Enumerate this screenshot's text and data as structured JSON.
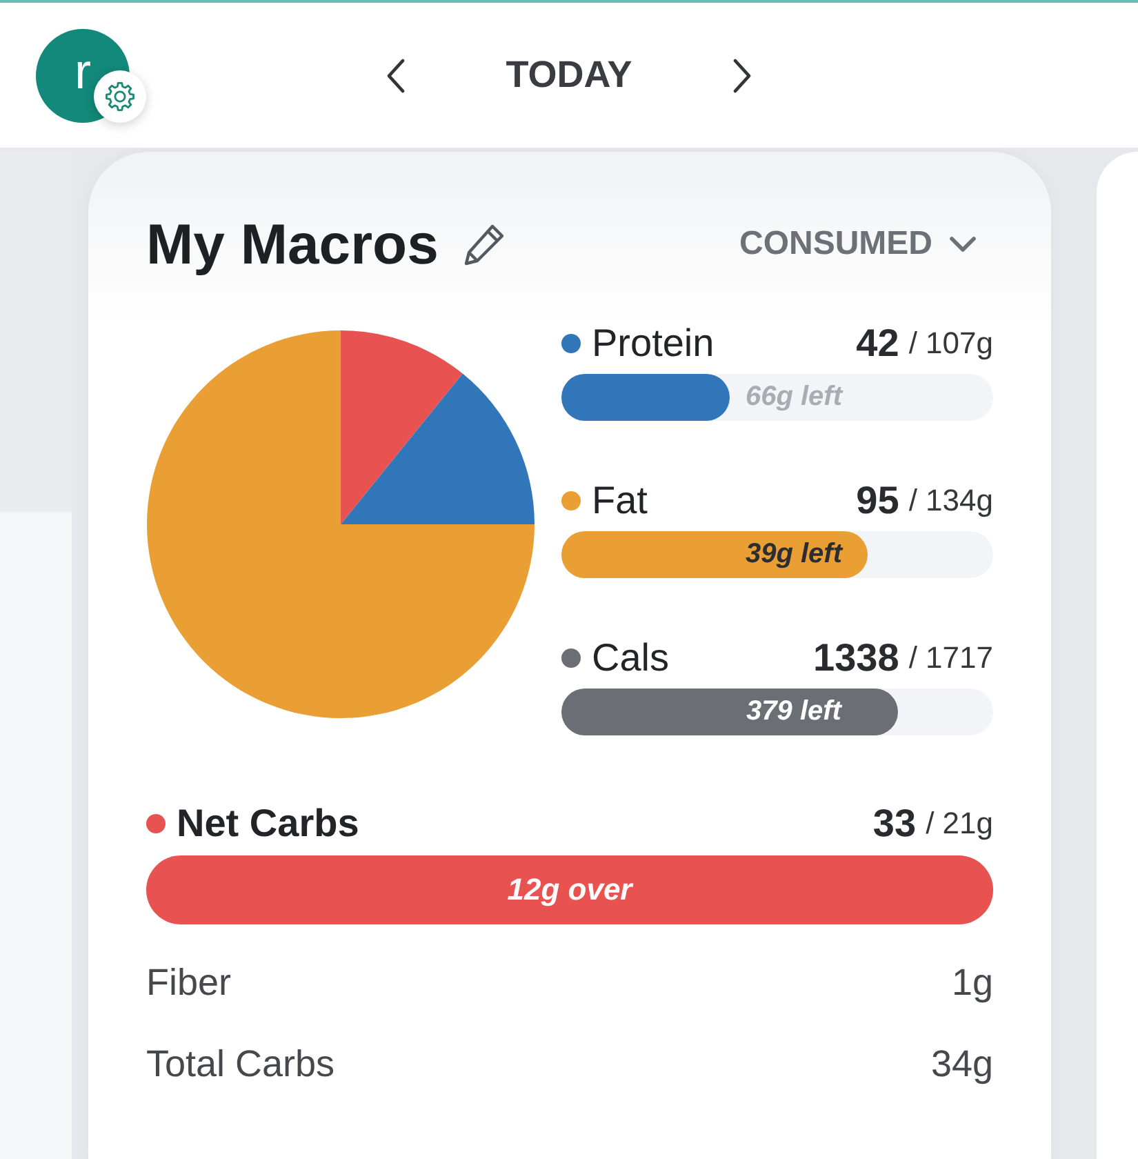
{
  "header": {
    "avatar_letter": "r",
    "date": "TODAY"
  },
  "card": {
    "title": "My Macros",
    "view_mode": "CONSUMED",
    "macros": [
      {
        "name": "Protein",
        "color": "#3176b9",
        "amount": "42",
        "goal": "/ 107g",
        "level": 0.39,
        "bar_label": "66g left"
      },
      {
        "name": "Fat",
        "color": "#e99f33",
        "amount": "95",
        "goal": "/ 134g",
        "level": 0.71,
        "bar_label": "39g left"
      },
      {
        "name": "Cals",
        "color": "#6b6e75",
        "amount": "1338",
        "goal": "/ 1717",
        "level": 0.78,
        "bar_label": "379 left"
      }
    ],
    "net_carbs": {
      "name": "Net Carbs",
      "color": "#e85351",
      "amount": "33",
      "goal": "/ 21g",
      "level": 1,
      "bar_label": "12g over"
    },
    "details": [
      {
        "label": "Fiber",
        "value": "1g"
      },
      {
        "label": "Total Carbs",
        "value": "34g"
      }
    ]
  }
}
